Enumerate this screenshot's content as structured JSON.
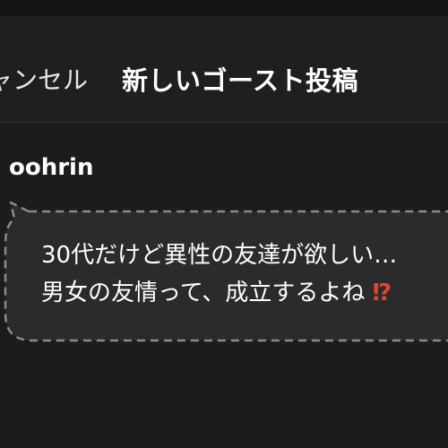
{
  "header": {
    "cancel_label": "ャンセル",
    "title": "新しいゴースト投稿"
  },
  "post": {
    "username": "oohrin",
    "line1": "30代だけど異性の友達が欲しい…",
    "line2": "男女の友情って、成立するよね",
    "line2_emoji": "⁉"
  },
  "colors": {
    "background": "#1c1c1c",
    "header_background": "#1f1f1f",
    "bubble_fill": "#2b2b2b",
    "bubble_border": "#8a8a8a",
    "emoji_color": "#e0442f"
  }
}
